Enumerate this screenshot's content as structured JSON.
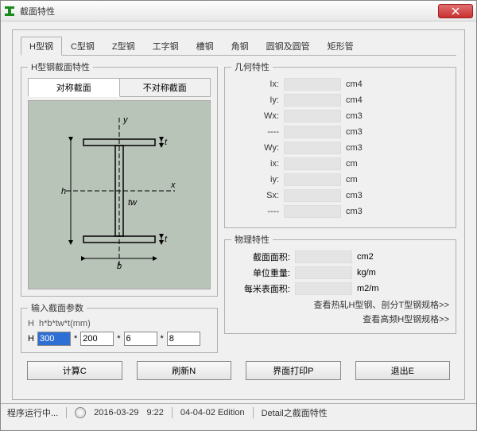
{
  "window": {
    "title": "截面特性"
  },
  "tabs": [
    "H型钢",
    "C型钢",
    "Z型钢",
    "工字钢",
    "槽钢",
    "角钢",
    "圆钢及圆管",
    "矩形管"
  ],
  "section_group": "H型钢截面特性",
  "sub_tabs": {
    "symmetric": "对称截面",
    "asymmetric": "不对称截面"
  },
  "diagram": {
    "y": "y",
    "x": "x",
    "h": "h",
    "b": "b",
    "tw": "tw",
    "t1": "t",
    "t2": "t"
  },
  "params": {
    "legend": "输入截面参数",
    "hint_label": "H",
    "hint": "h*b*tw*t(mm)",
    "label": "H",
    "h": "300",
    "b": "200",
    "tw": "6",
    "t": "8",
    "star": "*"
  },
  "geometry": {
    "legend": "几何特性",
    "rows": [
      {
        "label": "Ix:",
        "unit": "cm4"
      },
      {
        "label": "Iy:",
        "unit": "cm4"
      },
      {
        "label": "Wx:",
        "unit": "cm3"
      },
      {
        "label": "----",
        "unit": "cm3"
      },
      {
        "label": "Wy:",
        "unit": "cm3"
      },
      {
        "label": "ix:",
        "unit": "cm"
      },
      {
        "label": "iy:",
        "unit": "cm"
      },
      {
        "label": "Sx:",
        "unit": "cm3"
      },
      {
        "label": "----",
        "unit": "cm3"
      }
    ]
  },
  "physical": {
    "legend": "物理特性",
    "rows": [
      {
        "label": "截面面积:",
        "unit": "cm2"
      },
      {
        "label": "单位重量:",
        "unit": "kg/m"
      },
      {
        "label": "每米表面积:",
        "unit": "m2/m"
      }
    ],
    "link1": "查看热轧H型钢、剖分T型钢规格>>",
    "link2": "查看高频H型钢规格>>"
  },
  "buttons": {
    "calc": "计算C",
    "refresh": "刷新N",
    "print": "界面打印P",
    "exit": "退出E"
  },
  "status": {
    "running": "程序运行中...",
    "date": "2016-03-29",
    "time": "9:22",
    "edition": "04-04-02 Edition",
    "detail": "Detail之截面特性"
  }
}
